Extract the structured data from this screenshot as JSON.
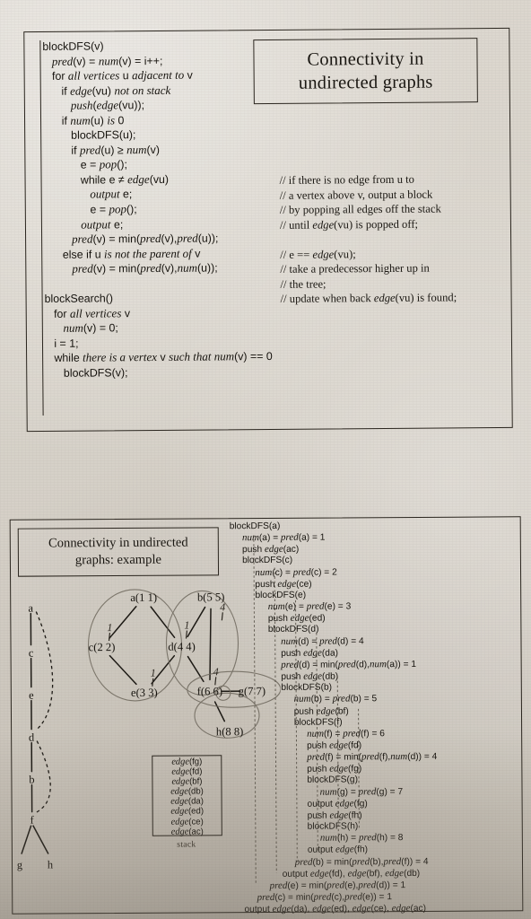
{
  "page": {
    "background_color": "#d9d4cc",
    "ink_color": "#1a1712"
  },
  "top_slide": {
    "title": {
      "line1": "Connectivity in",
      "line2": "undirected graphs"
    },
    "code_lines": [
      "blockDFS(v)",
      "   <i>pred</i>(v) = <i>num</i>(v) = i++;",
      "   for <i>all vertices</i> u <i>adjacent to</i> v",
      "      if <i>edge</i>(vu) <i>not on stack</i>",
      "         <i>push</i>(<i>edge</i>(vu));",
      "      if <i>num</i>(u) <i>is</i> 0",
      "         blockDFS(u);",
      "         if <i>pred</i>(u) ≥ <i>num</i>(v)",
      "            e = <i>pop</i>();",
      "            while e ≠ <i>edge</i>(vu)",
      "               <i>output</i> e;",
      "               e = <i>pop</i>();",
      "            <i>output</i> e;",
      "         <i>pred</i>(v) = min(<i>pred</i>(v),<i>pred</i>(u));",
      "      else if u <i>is not the parent of</i> v",
      "         <i>pred</i>(v) = min(<i>pred</i>(v),<i>num</i>(u));",
      "",
      "blockSearch()",
      "   for <i>all vertices</i> v",
      "      <i>num</i>(v) = 0;",
      "   i = 1;",
      "   while <i>there is a vertex</i> v <i>such that num</i>(v) == 0",
      "      blockDFS(v);"
    ],
    "comment_lines": [
      "// if there is no edge from u to",
      "// a vertex above v, output a block",
      "// by popping all edges off the stack",
      "// until <i>edge</i>(vu) is popped off;",
      "",
      "// e == <i>edge</i>(vu);",
      "// take a predecessor higher up in",
      "// the tree;",
      "// update when back <i>edge</i>(vu) is found;"
    ]
  },
  "bottom_slide": {
    "title": {
      "line1": "Connectivity in undirected",
      "line2": "graphs: example"
    },
    "stack": {
      "caption": "stack",
      "entries": [
        "edge(fg)",
        "edge(fd)",
        "edge(bf)",
        "edge(db)",
        "edge(da)",
        "edge(ed)",
        "edge(ce)",
        "edge(ac)"
      ]
    },
    "trace_lines": [
      "blockDFS(a)",
      "     <i>num</i>(a) = <i>pred</i>(a) = 1",
      "     push <i>edge</i>(ac)",
      "     blockDFS(c)",
      "          <i>num</i>(c) = <i>pred</i>(c) = 2",
      "          push <i>edge</i>(ce)",
      "          blockDFS(e)",
      "               <i>num</i>(e) = <i>pred</i>(e) = 3",
      "               push <i>edge</i>(ed)",
      "               blockDFS(d)",
      "                    <i>num</i>(d) = <i>pred</i>(d) = 4",
      "                    push <i>edge</i>(da)",
      "                    <i>pred</i>(d) = min(<i>pred</i>(d),<i>num</i>(a)) = 1",
      "                    push <i>edge</i>(db)",
      "                    blockDFS(b)",
      "                         <i>num</i>(b) = <i>pred</i>(b) = 5",
      "                         push <i>edge</i>(bf)",
      "                         blockDFS(f)",
      "                              <i>num</i>(f) = <i>pred</i>(f) = 6",
      "                              push <i>edge</i>(fd)",
      "                              <i>pred</i>(f) = min(<i>pred</i>(f),<i>num</i>(d)) = 4",
      "                              push <i>edge</i>(fg)",
      "                              blockDFS(g)",
      "                                   <i>num</i>(g) = <i>pred</i>(g) = 7",
      "                              output <i>edge</i>(fg)",
      "                              push <i>edge</i>(fh)",
      "                              blockDFS(h)",
      "                                   <i>num</i>(h) = <i>pred</i>(h) = 8",
      "                              output <i>edge</i>(fh)",
      "                         <i>pred</i>(b) = min(<i>pred</i>(b),<i>pred</i>(f)) = 4",
      "                    output <i>edge</i>(fd), <i>edge</i>(bf), <i>edge</i>(db)",
      "               <i>pred</i>(e) = min(<i>pred</i>(e),<i>pred</i>(d)) = 1",
      "          <i>pred</i>(c) = min(<i>pred</i>(c),<i>pred</i>(e)) = 1",
      "     output <i>edge</i>(da), <i>edge</i>(ed), <i>edge</i>(ce), <i>edge</i>(ac)"
    ],
    "dfs_tree": {
      "nodes": [
        "a",
        "c",
        "e",
        "d",
        "b",
        "f",
        "g",
        "h"
      ],
      "tree_edges": [
        [
          "a",
          "c"
        ],
        [
          "c",
          "e"
        ],
        [
          "e",
          "d"
        ],
        [
          "d",
          "b"
        ],
        [
          "b",
          "f"
        ],
        [
          "f",
          "g"
        ],
        [
          "f",
          "h"
        ]
      ],
      "back_edges": [
        [
          "a",
          "d"
        ],
        [
          "d",
          "f"
        ]
      ]
    },
    "graph": {
      "nodes": [
        {
          "id": "a",
          "label": "a(1 1)",
          "handwritten": ""
        },
        {
          "id": "b",
          "label": "b(5 5)",
          "handwritten": "4"
        },
        {
          "id": "c",
          "label": "c(2 2)",
          "handwritten": "1"
        },
        {
          "id": "d",
          "label": "d(4 4)",
          "handwritten": "1"
        },
        {
          "id": "e",
          "label": "e(3 3)",
          "handwritten": "1"
        },
        {
          "id": "f",
          "label": "f(6 6)",
          "handwritten": "4"
        },
        {
          "id": "g",
          "label": "g(7 7)",
          "handwritten": ""
        },
        {
          "id": "h",
          "label": "h(8 8)",
          "handwritten": ""
        }
      ],
      "edges": [
        [
          "a",
          "c"
        ],
        [
          "a",
          "d"
        ],
        [
          "c",
          "e"
        ],
        [
          "e",
          "d"
        ],
        [
          "d",
          "b"
        ],
        [
          "d",
          "f"
        ],
        [
          "b",
          "f"
        ],
        [
          "f",
          "g"
        ],
        [
          "f",
          "h"
        ]
      ],
      "blocks": [
        "{a,c,d,e}",
        "{b,d,f}",
        "{f,g}",
        "{f,h}"
      ]
    }
  }
}
